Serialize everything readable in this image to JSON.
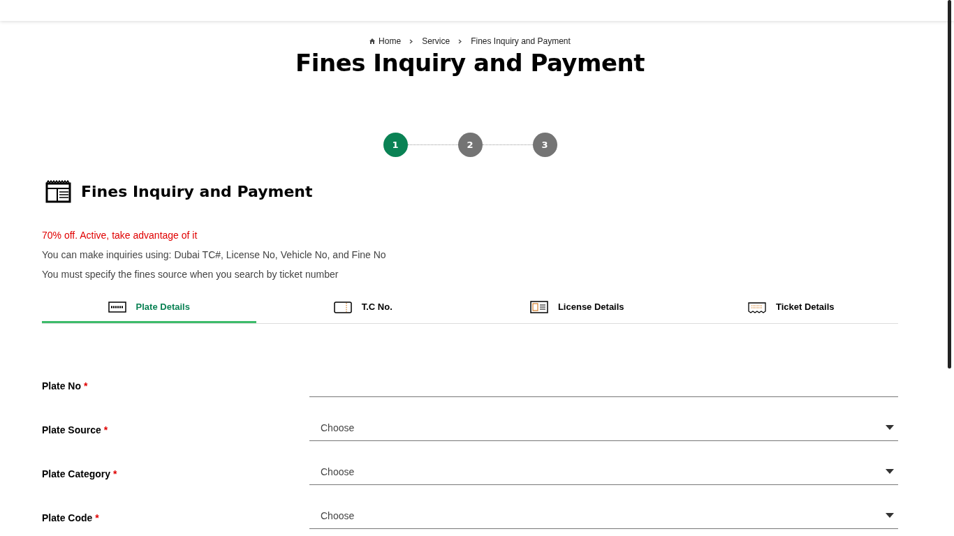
{
  "breadcrumb": [
    {
      "label": "Home",
      "kind": "home"
    },
    {
      "label": "Service",
      "kind": "link"
    },
    {
      "label": "Fines Inquiry and Payment",
      "kind": "link"
    }
  ],
  "page_title": "Fines Inquiry and Payment",
  "steps": [
    {
      "label": "1",
      "selected": true
    },
    {
      "label": "2",
      "selected": false
    },
    {
      "label": "3",
      "selected": false
    }
  ],
  "section_title": "Fines Inquiry and Payment",
  "notices": [
    {
      "text": "70% off. Active, take advantage of it",
      "kind": "alert"
    },
    {
      "text": "You can make inquiries using: Dubai TC#, License No, Vehicle No, and Fine No",
      "kind": "info"
    },
    {
      "text": "You must specify the fines source when you search by ticket number",
      "kind": "info"
    }
  ],
  "tabs": [
    {
      "label": "Plate Details",
      "kind": "plate",
      "selected": true
    },
    {
      "label": "T.C No.",
      "kind": "card",
      "selected": false
    },
    {
      "label": "License Details",
      "kind": "license",
      "selected": false
    },
    {
      "label": "Ticket Details",
      "kind": "ticket",
      "selected": false
    }
  ],
  "fields": [
    {
      "label": "Plate No",
      "required_mark": "*",
      "kind": "text"
    },
    {
      "label": "Plate Source",
      "required_mark": "*",
      "kind": "select",
      "placeholder": "Choose"
    },
    {
      "label": "Plate Category",
      "required_mark": "*",
      "kind": "select",
      "placeholder": "Choose"
    },
    {
      "label": "Plate Code",
      "required_mark": "*",
      "kind": "select",
      "placeholder": "Choose"
    }
  ]
}
